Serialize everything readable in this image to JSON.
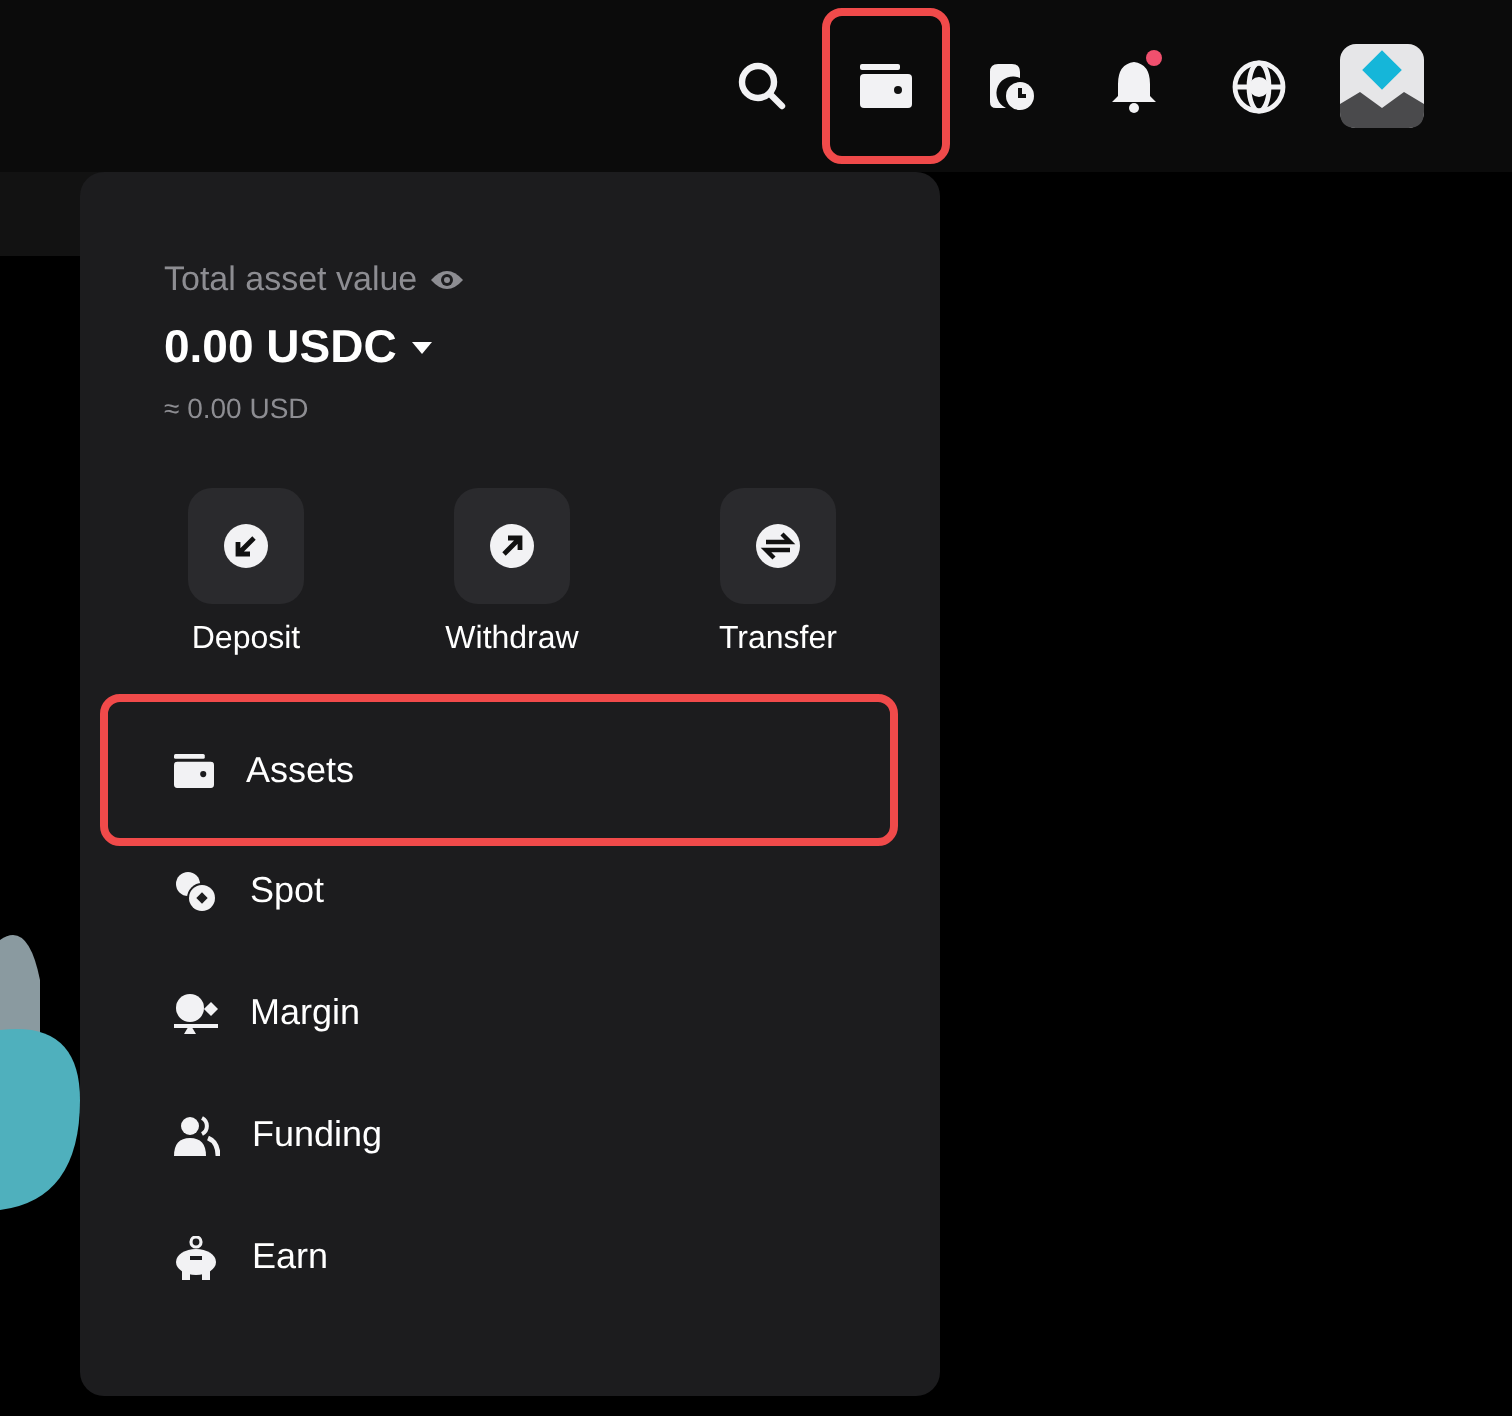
{
  "top_bar": {
    "icons": [
      {
        "kind": "search",
        "highlighted": false,
        "badge": false
      },
      {
        "kind": "wallet",
        "highlighted": true,
        "badge": false
      },
      {
        "kind": "history",
        "highlighted": false,
        "badge": false
      },
      {
        "kind": "bell",
        "highlighted": false,
        "badge": true
      },
      {
        "kind": "globe",
        "highlighted": false,
        "badge": false
      },
      {
        "kind": "avatar",
        "highlighted": false,
        "badge": false
      }
    ]
  },
  "wallet_menu": {
    "label": "Total asset value",
    "balance": "0.00 USDC",
    "converted": "≈ 0.00 USD",
    "actions": [
      {
        "kind": "deposit",
        "label": "Deposit"
      },
      {
        "kind": "withdraw",
        "label": "Withdraw"
      },
      {
        "kind": "transfer",
        "label": "Transfer"
      }
    ],
    "items": [
      {
        "kind": "wallet",
        "label": "Assets",
        "highlighted": true
      },
      {
        "kind": "coins",
        "label": "Spot",
        "highlighted": false
      },
      {
        "kind": "margin",
        "label": "Margin",
        "highlighted": false
      },
      {
        "kind": "people",
        "label": "Funding",
        "highlighted": false
      },
      {
        "kind": "piggy",
        "label": "Earn",
        "highlighted": false
      }
    ]
  }
}
